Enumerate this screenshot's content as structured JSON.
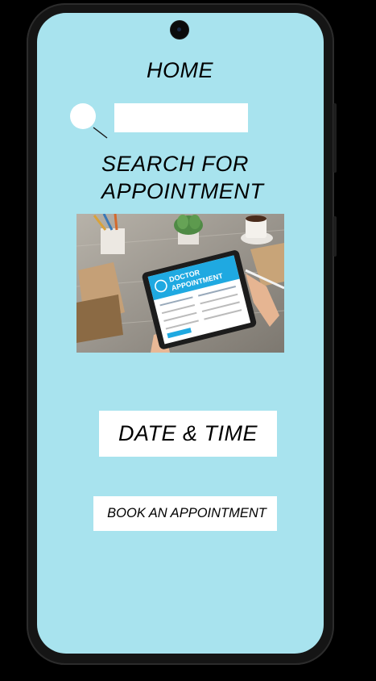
{
  "home": {
    "title": "HOME"
  },
  "search": {
    "input_value": "",
    "heading": "SEARCH FOR\nAPPOINTMENT",
    "icon": "search-icon"
  },
  "hero": {
    "tablet_title_line1": "DOCTOR",
    "tablet_title_line2": "APPOINTMENT"
  },
  "actions": {
    "date_time_label": "DATE & TIME",
    "book_label": "BOOK AN APPOINTMENT"
  },
  "colors": {
    "screen_background": "#a8e3ee",
    "button_background": "#ffffff",
    "tablet_accent": "#1fa9e1"
  }
}
